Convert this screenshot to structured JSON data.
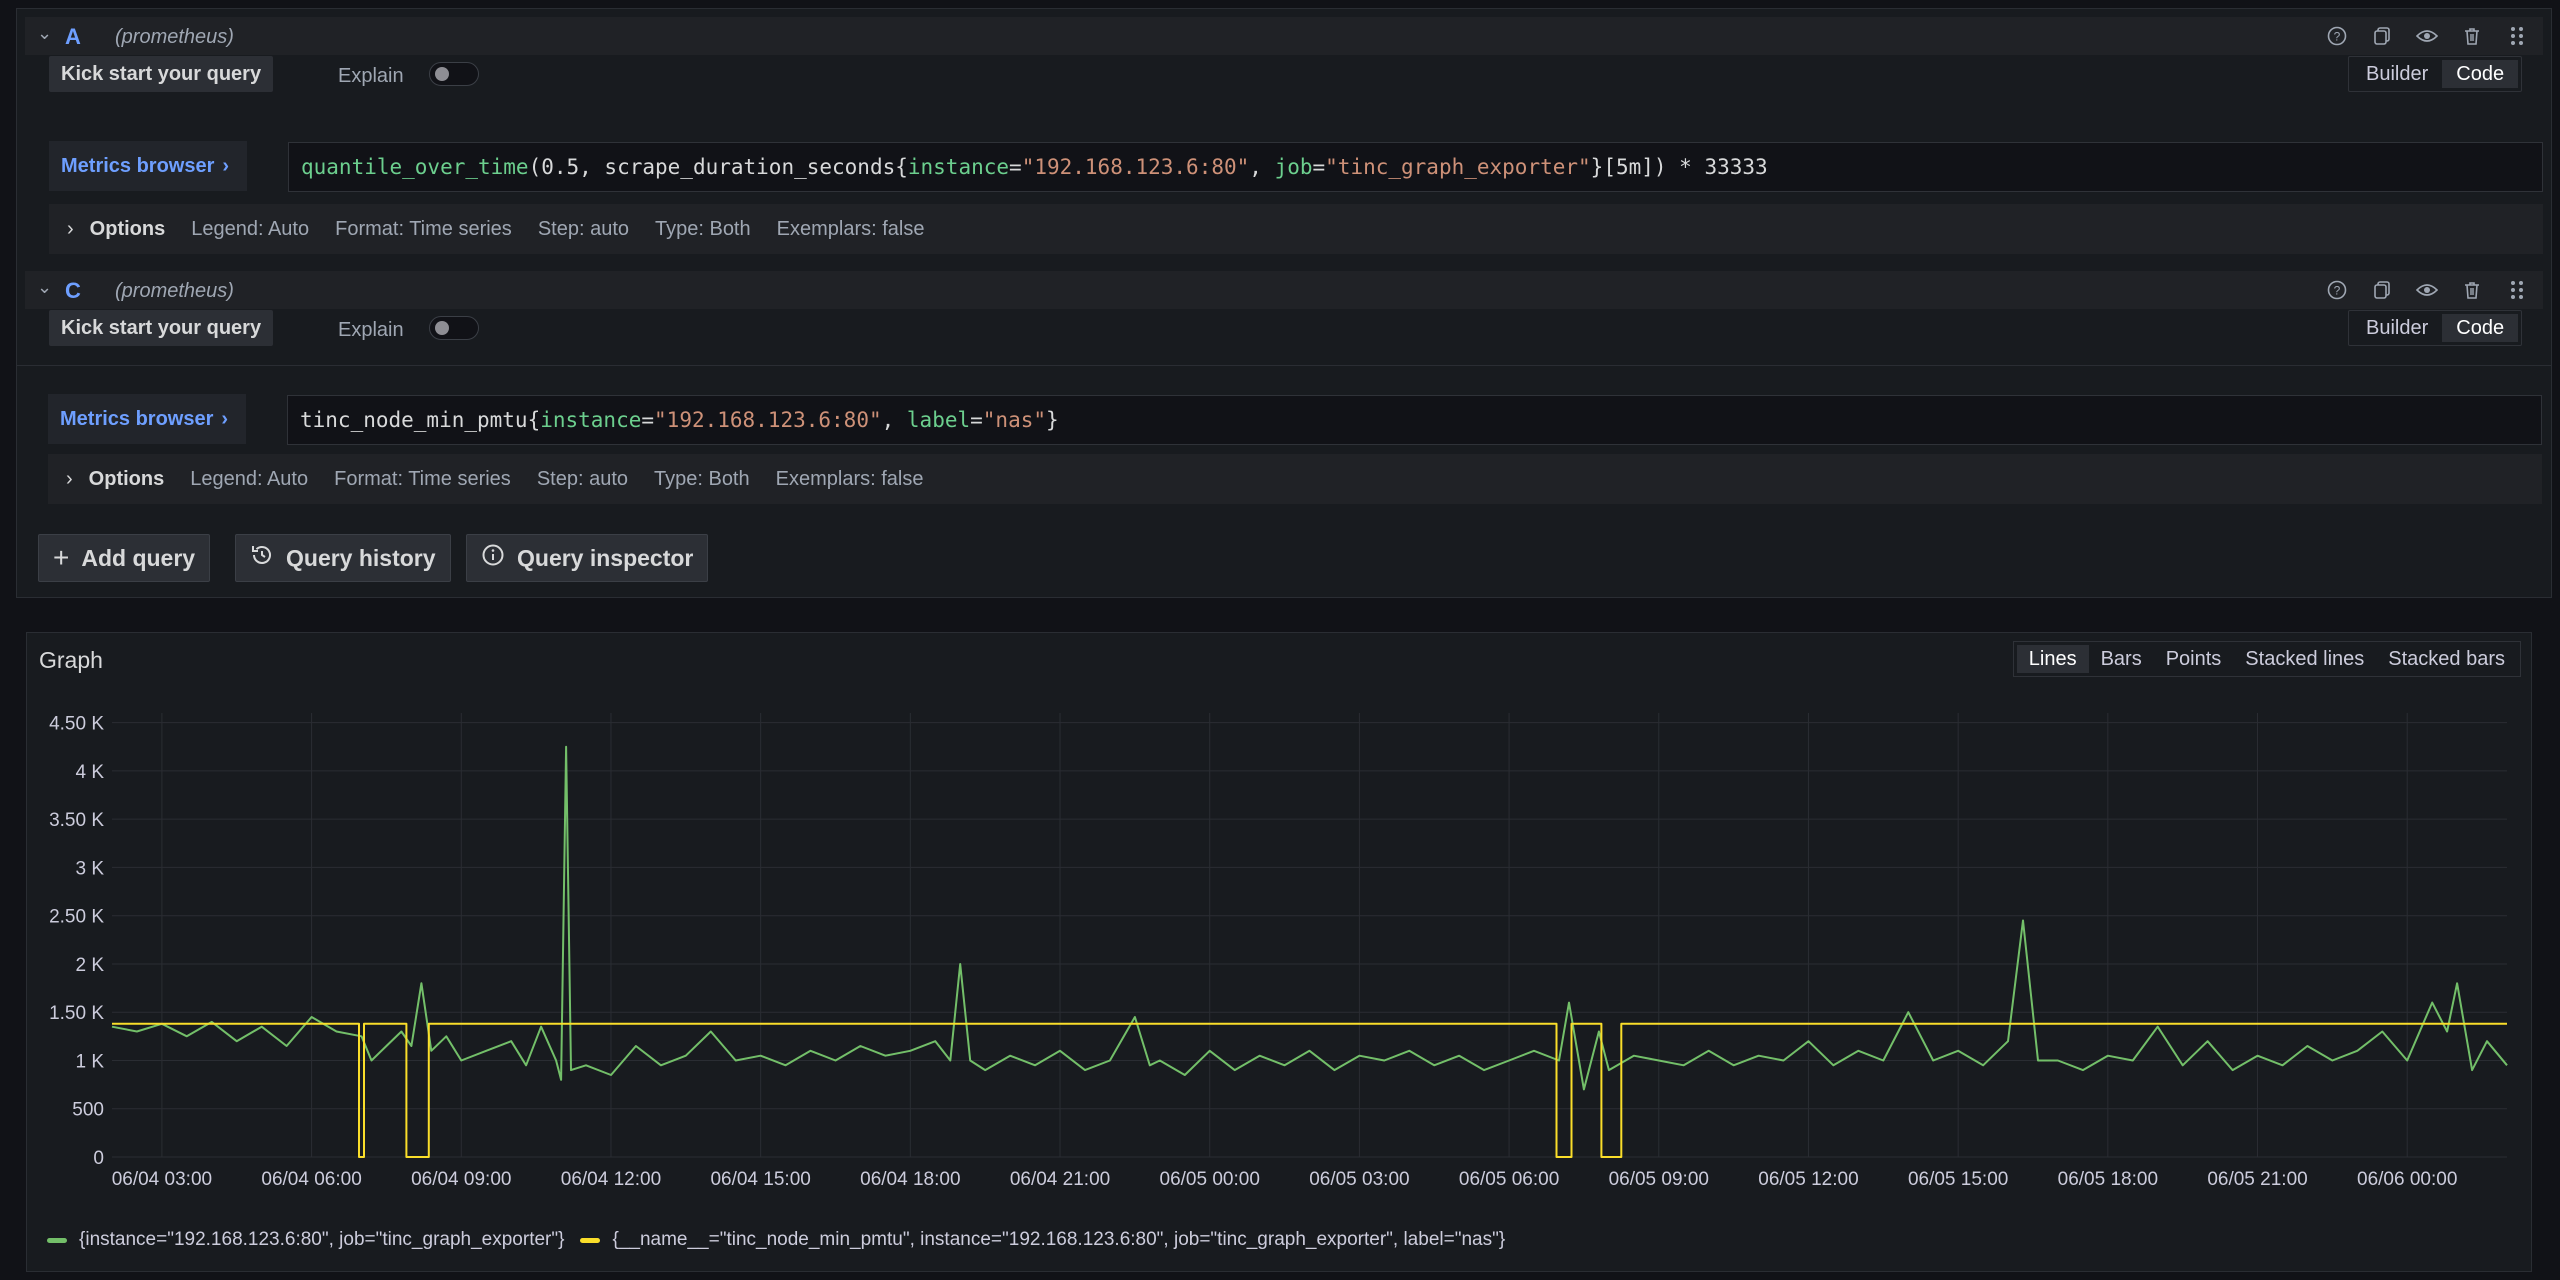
{
  "queries": [
    {
      "letter": "A",
      "datasource": "(prometheus)",
      "kickstart_label": "Kick start your query",
      "explain_label": "Explain",
      "explain_on": false,
      "builder_label": "Builder",
      "code_label": "Code",
      "mode": "Code",
      "metrics_browser_label": "Metrics browser",
      "expr": "quantile_over_time(0.5, scrape_duration_seconds{instance=\"192.168.123.6:80\", job=\"tinc_graph_exporter\"}[5m]) * 33333",
      "options": {
        "label": "Options",
        "legend": "Legend: Auto",
        "format": "Format: Time series",
        "step": "Step: auto",
        "type": "Type: Both",
        "exemplars": "Exemplars: false"
      }
    },
    {
      "letter": "C",
      "datasource": "(prometheus)",
      "kickstart_label": "Kick start your query",
      "explain_label": "Explain",
      "explain_on": false,
      "builder_label": "Builder",
      "code_label": "Code",
      "mode": "Code",
      "metrics_browser_label": "Metrics browser",
      "expr": "tinc_node_min_pmtu{instance=\"192.168.123.6:80\", label=\"nas\"}",
      "options": {
        "label": "Options",
        "legend": "Legend: Auto",
        "format": "Format: Time series",
        "step": "Step: auto",
        "type": "Type: Both",
        "exemplars": "Exemplars: false"
      }
    }
  ],
  "actions": {
    "add_query": "Add query",
    "query_history": "Query history",
    "query_inspector": "Query inspector"
  },
  "graph": {
    "title": "Graph",
    "modes": [
      "Lines",
      "Bars",
      "Points",
      "Stacked lines",
      "Stacked bars"
    ],
    "active_mode": "Lines"
  },
  "chart_data": {
    "type": "line",
    "title": "Graph",
    "y_ticks": [
      "0",
      "500",
      "1 K",
      "1.50 K",
      "2 K",
      "2.50 K",
      "3 K",
      "3.50 K",
      "4 K",
      "4.50 K"
    ],
    "ylim": [
      0,
      4600
    ],
    "x_ticks": [
      "06/04 03:00",
      "06/04 06:00",
      "06/04 09:00",
      "06/04 12:00",
      "06/04 15:00",
      "06/04 18:00",
      "06/04 21:00",
      "06/05 00:00",
      "06/05 03:00",
      "06/05 06:00",
      "06/05 09:00",
      "06/05 12:00",
      "06/05 15:00",
      "06/05 18:00",
      "06/05 21:00",
      "06/06 00:00"
    ],
    "xlim_hours": [
      2.0,
      50.0
    ],
    "grid": true,
    "legend_position": "bottom",
    "series": [
      {
        "name": "{instance=\"192.168.123.6:80\", job=\"tinc_graph_exporter\"}",
        "color": "#73bf69",
        "points": [
          [
            2.0,
            1350
          ],
          [
            2.5,
            1300
          ],
          [
            3.0,
            1380
          ],
          [
            3.5,
            1250
          ],
          [
            4.0,
            1400
          ],
          [
            4.5,
            1200
          ],
          [
            5.0,
            1350
          ],
          [
            5.5,
            1150
          ],
          [
            6.0,
            1450
          ],
          [
            6.5,
            1300
          ],
          [
            7.0,
            1250
          ],
          [
            7.2,
            1000
          ],
          [
            7.5,
            1150
          ],
          [
            7.8,
            1300
          ],
          [
            8.0,
            1150
          ],
          [
            8.2,
            1800
          ],
          [
            8.4,
            1100
          ],
          [
            8.7,
            1250
          ],
          [
            9.0,
            1000
          ],
          [
            9.5,
            1100
          ],
          [
            10.0,
            1200
          ],
          [
            10.3,
            950
          ],
          [
            10.6,
            1350
          ],
          [
            10.9,
            1000
          ],
          [
            11.0,
            800
          ],
          [
            11.1,
            4250
          ],
          [
            11.2,
            900
          ],
          [
            11.5,
            950
          ],
          [
            12.0,
            850
          ],
          [
            12.5,
            1150
          ],
          [
            13.0,
            950
          ],
          [
            13.5,
            1050
          ],
          [
            14.0,
            1300
          ],
          [
            14.5,
            1000
          ],
          [
            15.0,
            1050
          ],
          [
            15.5,
            950
          ],
          [
            16.0,
            1100
          ],
          [
            16.5,
            1000
          ],
          [
            17.0,
            1150
          ],
          [
            17.5,
            1050
          ],
          [
            18.0,
            1100
          ],
          [
            18.5,
            1200
          ],
          [
            18.8,
            1000
          ],
          [
            19.0,
            2000
          ],
          [
            19.2,
            1000
          ],
          [
            19.5,
            900
          ],
          [
            20.0,
            1050
          ],
          [
            20.5,
            950
          ],
          [
            21.0,
            1100
          ],
          [
            21.5,
            900
          ],
          [
            22.0,
            1000
          ],
          [
            22.5,
            1450
          ],
          [
            22.8,
            950
          ],
          [
            23.0,
            1000
          ],
          [
            23.5,
            850
          ],
          [
            24.0,
            1100
          ],
          [
            24.5,
            900
          ],
          [
            25.0,
            1050
          ],
          [
            25.5,
            950
          ],
          [
            26.0,
            1100
          ],
          [
            26.5,
            900
          ],
          [
            27.0,
            1050
          ],
          [
            27.5,
            1000
          ],
          [
            28.0,
            1100
          ],
          [
            28.5,
            950
          ],
          [
            29.0,
            1050
          ],
          [
            29.5,
            900
          ],
          [
            30.0,
            1000
          ],
          [
            30.5,
            1100
          ],
          [
            31.0,
            1000
          ],
          [
            31.2,
            1600
          ],
          [
            31.5,
            700
          ],
          [
            31.8,
            1300
          ],
          [
            32.0,
            900
          ],
          [
            32.5,
            1050
          ],
          [
            33.0,
            1000
          ],
          [
            33.5,
            950
          ],
          [
            34.0,
            1100
          ],
          [
            34.5,
            950
          ],
          [
            35.0,
            1050
          ],
          [
            35.5,
            1000
          ],
          [
            36.0,
            1200
          ],
          [
            36.5,
            950
          ],
          [
            37.0,
            1100
          ],
          [
            37.5,
            1000
          ],
          [
            38.0,
            1500
          ],
          [
            38.5,
            1000
          ],
          [
            39.0,
            1100
          ],
          [
            39.5,
            950
          ],
          [
            40.0,
            1200
          ],
          [
            40.3,
            2450
          ],
          [
            40.6,
            1000
          ],
          [
            41.0,
            1000
          ],
          [
            41.5,
            900
          ],
          [
            42.0,
            1050
          ],
          [
            42.5,
            1000
          ],
          [
            43.0,
            1350
          ],
          [
            43.5,
            950
          ],
          [
            44.0,
            1200
          ],
          [
            44.5,
            900
          ],
          [
            45.0,
            1050
          ],
          [
            45.5,
            950
          ],
          [
            46.0,
            1150
          ],
          [
            46.5,
            1000
          ],
          [
            47.0,
            1100
          ],
          [
            47.5,
            1300
          ],
          [
            48.0,
            1000
          ],
          [
            48.5,
            1600
          ],
          [
            48.8,
            1300
          ],
          [
            49.0,
            1800
          ],
          [
            49.3,
            900
          ],
          [
            49.6,
            1200
          ],
          [
            50.0,
            950
          ]
        ]
      },
      {
        "name": "{__name__=\"tinc_node_min_pmtu\", instance=\"192.168.123.6:80\", job=\"tinc_graph_exporter\", label=\"nas\"}",
        "color": "#fade2a",
        "points": [
          [
            2.0,
            1380
          ],
          [
            6.95,
            1380
          ],
          [
            6.95,
            0
          ],
          [
            7.05,
            0
          ],
          [
            7.05,
            1380
          ],
          [
            7.9,
            1380
          ],
          [
            7.9,
            0
          ],
          [
            8.35,
            0
          ],
          [
            8.35,
            1380
          ],
          [
            30.95,
            1380
          ],
          [
            30.95,
            0
          ],
          [
            31.25,
            0
          ],
          [
            31.25,
            1380
          ],
          [
            31.85,
            1380
          ],
          [
            31.85,
            0
          ],
          [
            32.25,
            0
          ],
          [
            32.25,
            1380
          ],
          [
            50.0,
            1380
          ]
        ]
      }
    ]
  }
}
